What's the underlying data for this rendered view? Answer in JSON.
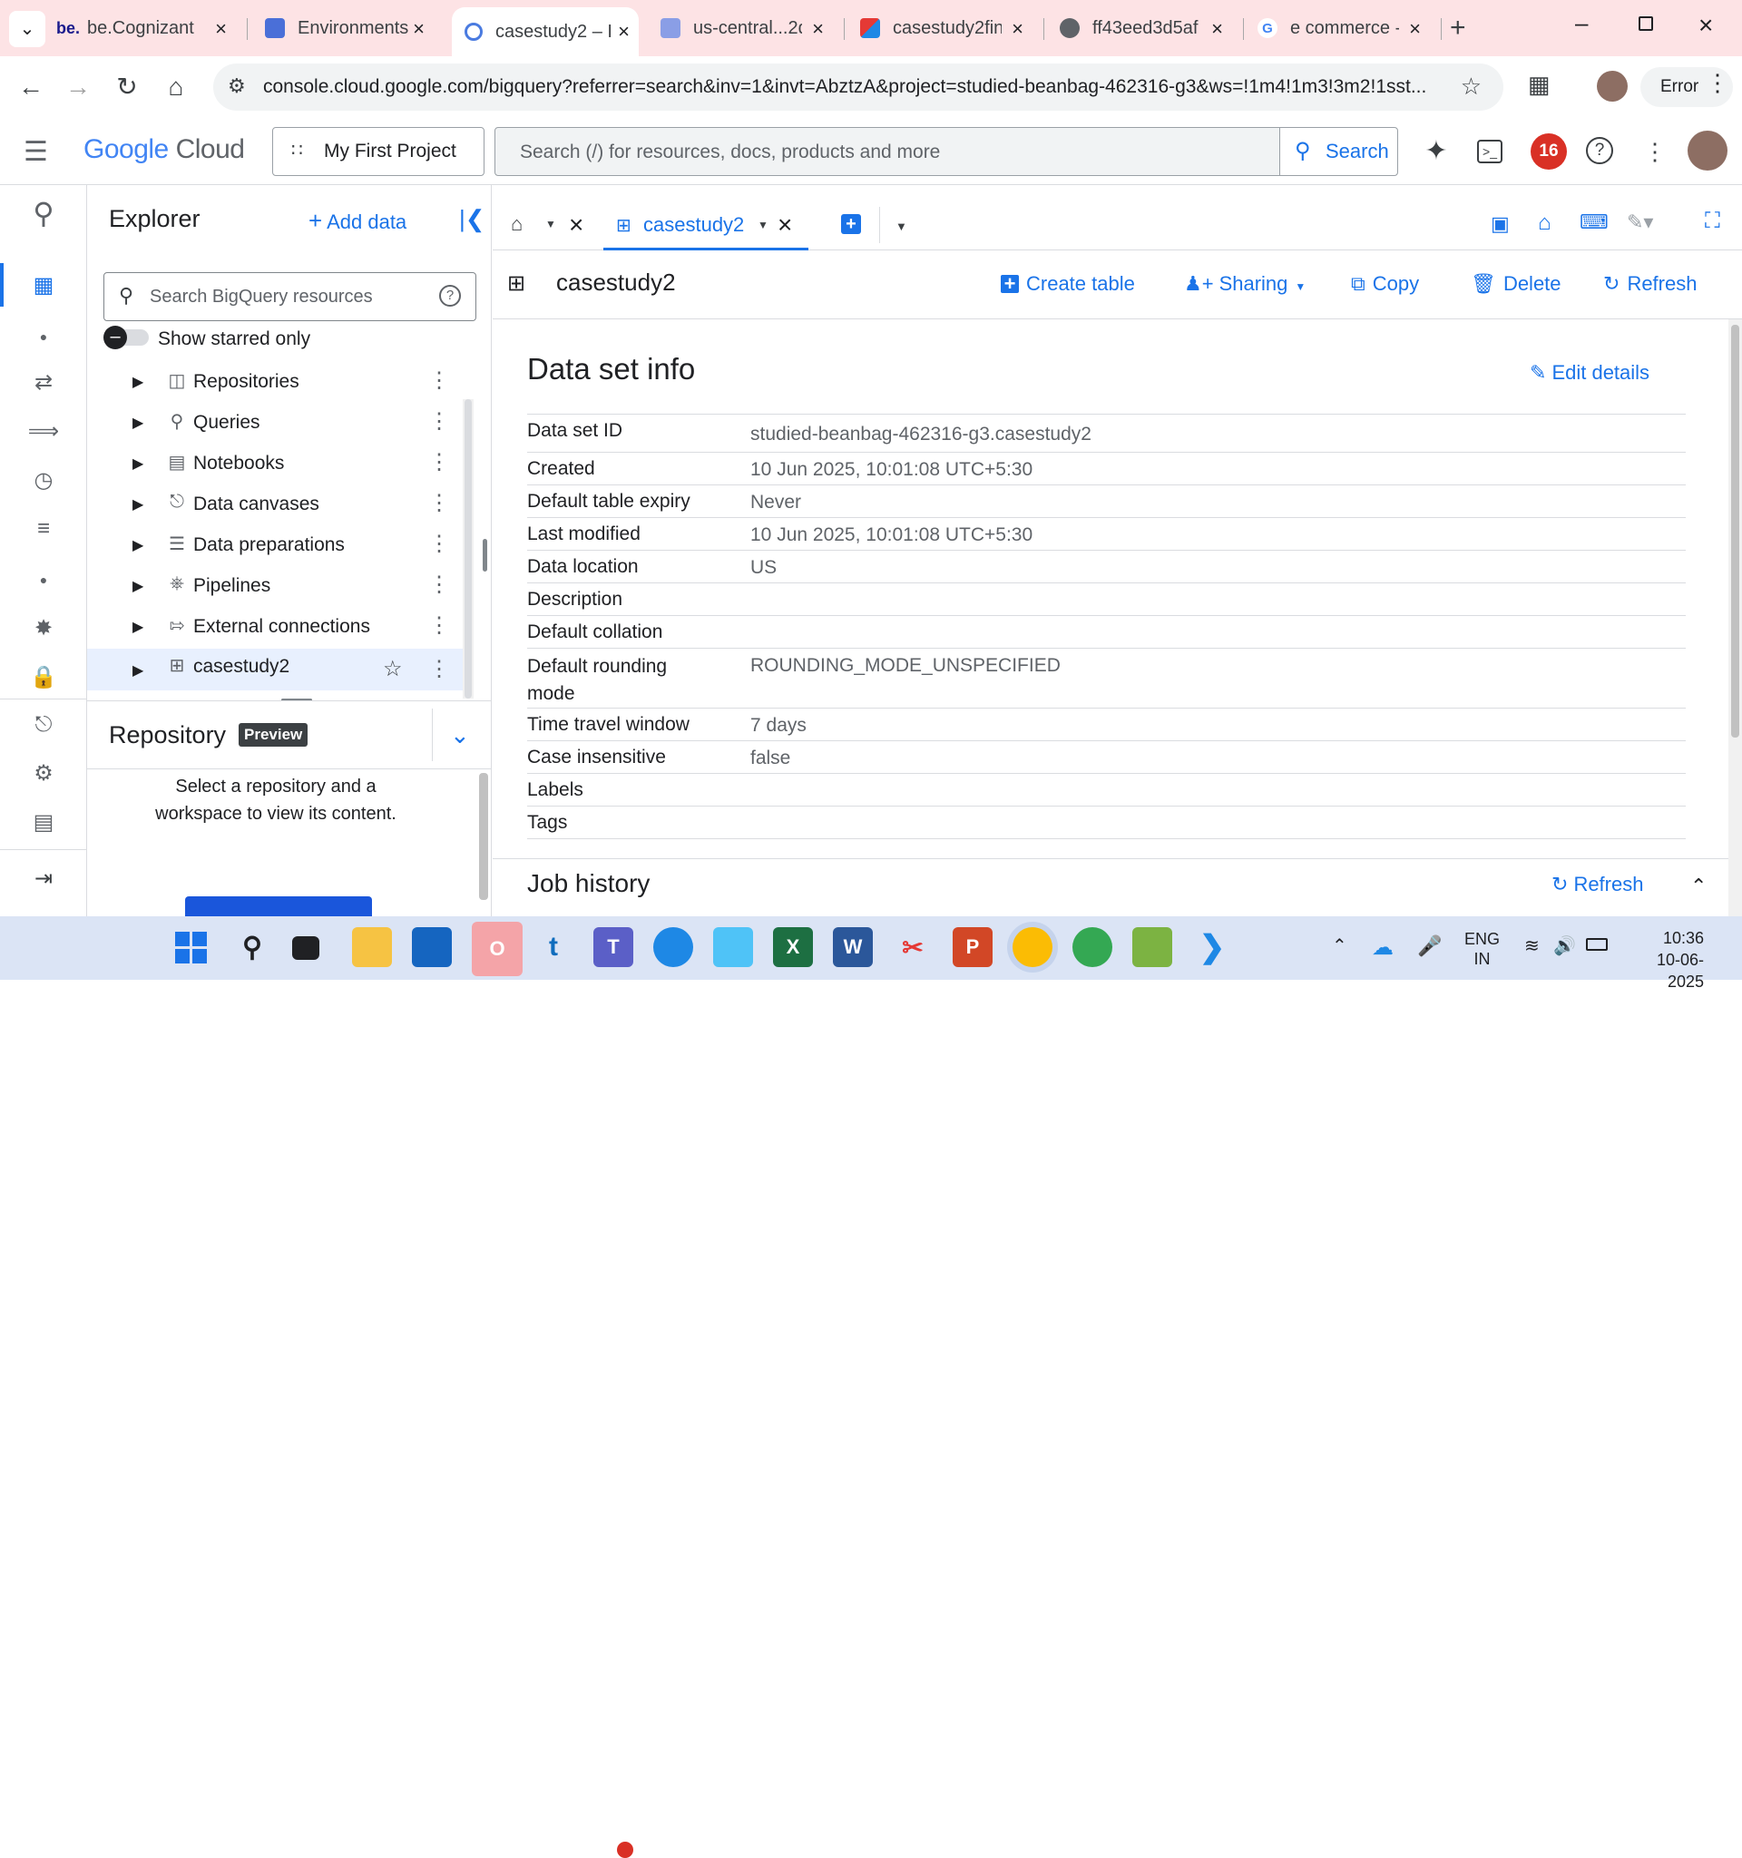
{
  "browser": {
    "tabs": [
      {
        "label": "be.Cognizant",
        "favicon_text": "be."
      },
      {
        "label": "Environments",
        "favicon_text": ""
      },
      {
        "label": "casestudy2 – I",
        "favicon_text": ""
      },
      {
        "label": "us-central...2d",
        "favicon_text": ""
      },
      {
        "label": "casestudy2fin",
        "favicon_text": ""
      },
      {
        "label": "ff43eed3d5af",
        "favicon_text": ""
      },
      {
        "label": "e commerce -",
        "favicon_text": "G"
      }
    ],
    "url": "console.cloud.google.com/bigquery?referrer=search&inv=1&invt=AbztzA&project=studied-beanbag-462316-g3&ws=!1m4!1m3!3m2!1sst...",
    "profile_status": "Error"
  },
  "gcp_header": {
    "logo_google": "Google",
    "logo_cloud": "Cloud",
    "project": "My First Project",
    "search_placeholder": "Search (/) for resources, docs, products and more",
    "search_button": "Search",
    "notification_count": "16"
  },
  "explorer": {
    "title": "Explorer",
    "add_data": "Add data",
    "search_placeholder": "Search BigQuery resources",
    "starred_label": "Show starred only",
    "items": [
      {
        "label": "Repositories",
        "icon": "repository-icon"
      },
      {
        "label": "Queries",
        "icon": "query-icon"
      },
      {
        "label": "Notebooks",
        "icon": "notebook-icon"
      },
      {
        "label": "Data canvases",
        "icon": "canvas-icon"
      },
      {
        "label": "Data preparations",
        "icon": "data-prep-icon"
      },
      {
        "label": "Pipelines",
        "icon": "pipeline-icon"
      },
      {
        "label": "External connections",
        "icon": "connection-icon"
      },
      {
        "label": "casestudy2",
        "icon": "dataset-icon"
      }
    ],
    "repository": {
      "title": "Repository",
      "badge": "Preview",
      "message": "Select a repository and a workspace to view its content."
    }
  },
  "main": {
    "tab_label": "casestudy2",
    "dataset_name": "casestudy2",
    "actions": {
      "create_table": "Create table",
      "sharing": "Sharing",
      "copy": "Copy",
      "delete": "Delete",
      "refresh": "Refresh"
    },
    "info_title": "Data set info",
    "edit_details": "Edit details",
    "info": [
      {
        "key": "Data set ID",
        "value": "studied-beanbag-462316-g3.casestudy2"
      },
      {
        "key": "Created",
        "value": "10 Jun 2025, 10:01:08 UTC+5:30"
      },
      {
        "key": "Default table expiry",
        "value": "Never"
      },
      {
        "key": "Last modified",
        "value": "10 Jun 2025, 10:01:08 UTC+5:30"
      },
      {
        "key": "Data location",
        "value": "US"
      },
      {
        "key": "Description",
        "value": ""
      },
      {
        "key": "Default collation",
        "value": ""
      },
      {
        "key": "Default rounding mode",
        "value": "ROUNDING_MODE_UNSPECIFIED"
      },
      {
        "key": "Time travel window",
        "value": "7 days"
      },
      {
        "key": "Case insensitive",
        "value": "false"
      },
      {
        "key": "Labels",
        "value": ""
      },
      {
        "key": "Tags",
        "value": ""
      }
    ],
    "job_history": "Job history",
    "job_refresh": "Refresh"
  },
  "taskbar": {
    "language": "ENG",
    "region": "IN",
    "time": "10:36",
    "date": "10-06-2025"
  },
  "colors": {
    "accent": "#1a73e8",
    "tabbar_bg": "#fde3e5",
    "notification": "#d93025"
  }
}
